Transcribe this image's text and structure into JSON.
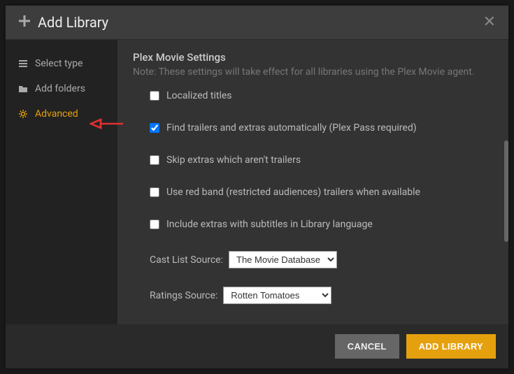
{
  "header": {
    "title": "Add Library"
  },
  "sidebar": {
    "items": [
      {
        "label": "Select type"
      },
      {
        "label": "Add folders"
      },
      {
        "label": "Advanced"
      }
    ]
  },
  "content": {
    "title": "Plex Movie Settings",
    "note": "Note: These settings will take effect for all libraries using the Plex Movie agent.",
    "checks": [
      {
        "label": "Localized titles",
        "checked": false
      },
      {
        "label": "Find trailers and extras automatically (Plex Pass required)",
        "checked": true
      },
      {
        "label": "Skip extras which aren't trailers",
        "checked": false
      },
      {
        "label": "Use red band (restricted audiences) trailers when available",
        "checked": false
      },
      {
        "label": "Include extras with subtitles in Library language",
        "checked": false
      }
    ],
    "selects": [
      {
        "label": "Cast List Source:",
        "value": "The Movie Database"
      },
      {
        "label": "Ratings Source:",
        "value": "Rotten Tomatoes"
      }
    ]
  },
  "footer": {
    "cancel": "CANCEL",
    "primary": "ADD LIBRARY"
  },
  "colors": {
    "accent": "#e5a00d"
  }
}
